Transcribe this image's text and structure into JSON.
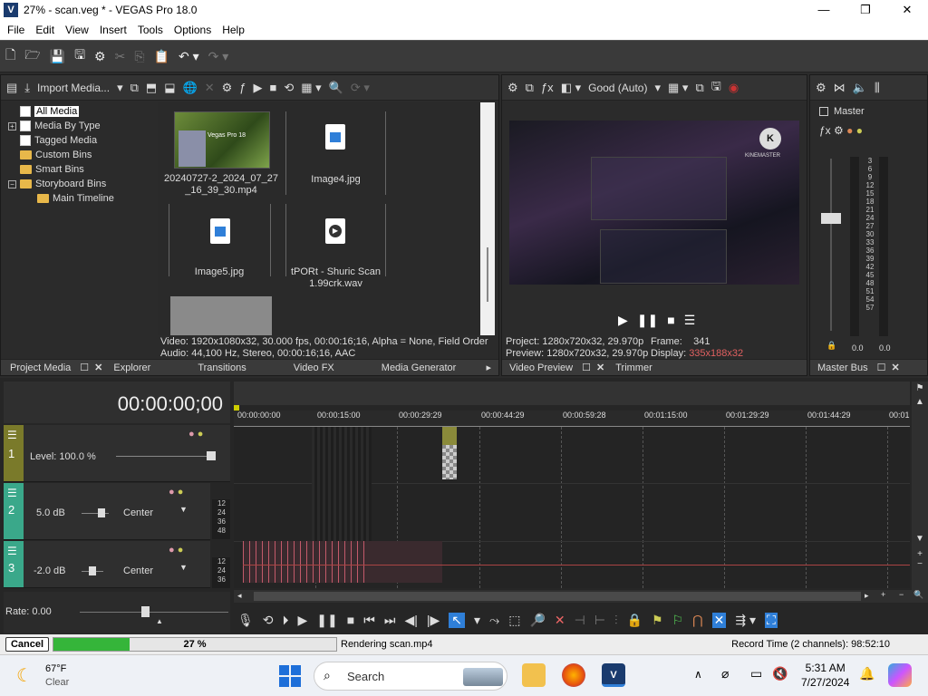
{
  "window": {
    "title": "27% - scan.veg * - VEGAS Pro 18.0",
    "app_icon": "V",
    "min": "—",
    "max": "❐",
    "close": "✕"
  },
  "menu": [
    "File",
    "Edit",
    "View",
    "Insert",
    "Tools",
    "Options",
    "Help"
  ],
  "project_media": {
    "import_label": "Import Media...",
    "tree": [
      {
        "label": "All Media",
        "selected": true
      },
      {
        "label": "Media By Type",
        "expand": "+"
      },
      {
        "label": "Tagged Media"
      },
      {
        "label": "Custom Bins"
      },
      {
        "label": "Smart Bins"
      },
      {
        "label": "Storyboard Bins",
        "expand": "−"
      },
      {
        "label": "Main Timeline"
      }
    ],
    "files": [
      {
        "label": "20240727-2_2024_07_27\n_16_39_30.mp4"
      },
      {
        "label": "Image4.jpg"
      },
      {
        "label": "Image5.jpg"
      },
      {
        "label": "tPORt - Shuric Scan\n1.99crk.wav"
      }
    ],
    "thumb_text": "Vegas Pro 18",
    "info_video": "Video: 1920x1080x32, 30.000 fps, 00:00:16;16, Alpha = None, Field Order",
    "info_audio": "Audio: 44,100 Hz, Stereo, 00:00:16;16, AAC",
    "tabs": [
      "Project Media",
      "Explorer",
      "Transitions",
      "Video FX",
      "Media Generator"
    ]
  },
  "preview": {
    "quality": "Good (Auto)",
    "watermark": "KINEMASTER",
    "project_label": "Project:",
    "project_value": "1280x720x32, 29.970p",
    "preview_label": "Preview:",
    "preview_value": "1280x720x32, 29.970p",
    "frame_label": "Frame:",
    "frame_value": "341",
    "display_label": "Display:",
    "display_value": "335x188x32",
    "tabs": [
      "Video Preview",
      "Trimmer"
    ]
  },
  "master": {
    "label": "Master",
    "scale": [
      "3",
      "6",
      "9",
      "12",
      "15",
      "18",
      "21",
      "24",
      "27",
      "30",
      "33",
      "36",
      "39",
      "42",
      "45",
      "48",
      "51",
      "54",
      "57"
    ],
    "readout_left": "0.0",
    "readout_right": "0.0",
    "tab": "Master Bus"
  },
  "timeline": {
    "timecode": "00:00:00;00",
    "ruler": [
      "00:00:00:00",
      "00:00:15:00",
      "00:00:29:29",
      "00:00:44:29",
      "00:00:59:28",
      "00:01:15:00",
      "00:01:29:29",
      "00:01:44:29",
      "00:01"
    ],
    "tracks": [
      {
        "num": "1",
        "level": "Level: 100.0 %",
        "color": "#7a7a2a"
      },
      {
        "num": "2",
        "level": "5.0 dB",
        "pan": "Center",
        "color": "#3aa88a"
      },
      {
        "num": "3",
        "level": "-2.0 dB",
        "pan": "Center",
        "color": "#3aa88a"
      }
    ],
    "meter_ticks": [
      "12",
      "24",
      "36",
      "48"
    ],
    "rate": "Rate: 0.00"
  },
  "status": {
    "cancel": "Cancel",
    "progress_text": "27 %",
    "progress": 0.27,
    "rendering": "Rendering scan.mp4",
    "record_time": "Record Time (2 channels): 98:52:10"
  },
  "taskbar": {
    "temp": "67°F",
    "weather": "Clear",
    "search": "Search",
    "time": "5:31 AM",
    "date": "7/27/2024"
  },
  "colors": {
    "accent": "#2f7fd8",
    "progress": "#35b53a",
    "display_value": "#e06060"
  }
}
